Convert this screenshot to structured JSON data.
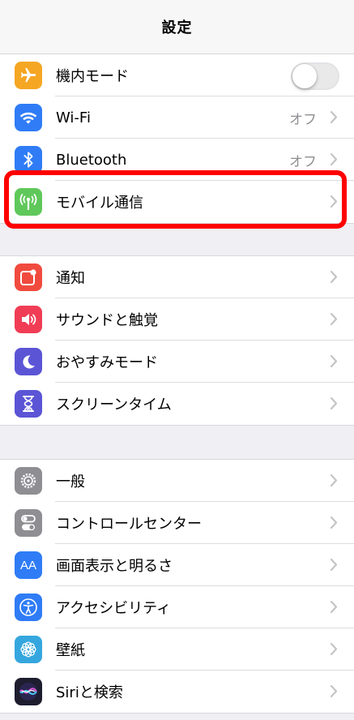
{
  "nav": {
    "title": "設定"
  },
  "group1": {
    "airplane": {
      "label": "機内モード",
      "icon": "airplane-icon",
      "color": "#f5a623",
      "toggle": false
    },
    "wifi": {
      "label": "Wi-Fi",
      "value": "オフ",
      "icon": "wifi-icon",
      "color": "#2f7cf6"
    },
    "bluetooth": {
      "label": "Bluetooth",
      "value": "オフ",
      "icon": "bluetooth-icon",
      "color": "#2f7cf6"
    },
    "cellular": {
      "label": "モバイル通信",
      "icon": "antenna-icon",
      "color": "#5fc85a",
      "highlighted": true
    }
  },
  "group2": {
    "notifications": {
      "label": "通知",
      "icon": "notification-icon",
      "color": "#f04b3e"
    },
    "sounds": {
      "label": "サウンドと触覚",
      "icon": "speaker-icon",
      "color": "#f03d55"
    },
    "dnd": {
      "label": "おやすみモード",
      "icon": "moon-icon",
      "color": "#5b55d6"
    },
    "screentime": {
      "label": "スクリーンタイム",
      "icon": "hourglass-icon",
      "color": "#5b55d6"
    }
  },
  "group3": {
    "general": {
      "label": "一般",
      "icon": "gear-icon",
      "color": "#8e8e93"
    },
    "control": {
      "label": "コントロールセンター",
      "icon": "switches-icon",
      "color": "#8e8e93"
    },
    "display": {
      "label": "画面表示と明るさ",
      "icon_text": "AA",
      "icon": "text-size-icon",
      "color": "#2f7cf6"
    },
    "accessibility": {
      "label": "アクセシビリティ",
      "icon": "accessibility-icon",
      "color": "#2f7cf6"
    },
    "wallpaper": {
      "label": "壁紙",
      "icon": "flower-icon",
      "color": "#35a7de"
    },
    "siri": {
      "label": "Siriと検索",
      "icon": "siri-icon",
      "color": "#1d1d2f"
    }
  },
  "highlight_color": "#ff0000"
}
